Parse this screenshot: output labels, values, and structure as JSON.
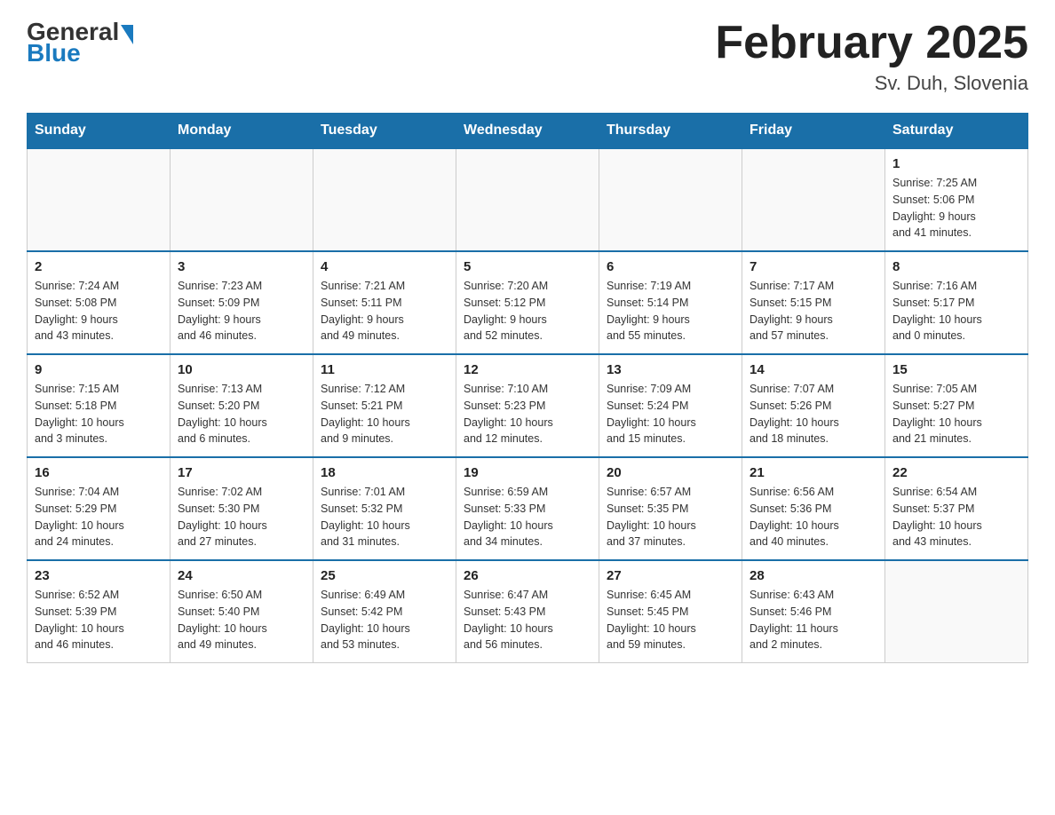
{
  "header": {
    "logo_general": "General",
    "logo_blue": "Blue",
    "month_title": "February 2025",
    "location": "Sv. Duh, Slovenia"
  },
  "days_of_week": [
    "Sunday",
    "Monday",
    "Tuesday",
    "Wednesday",
    "Thursday",
    "Friday",
    "Saturday"
  ],
  "weeks": [
    [
      {
        "day": "",
        "info": ""
      },
      {
        "day": "",
        "info": ""
      },
      {
        "day": "",
        "info": ""
      },
      {
        "day": "",
        "info": ""
      },
      {
        "day": "",
        "info": ""
      },
      {
        "day": "",
        "info": ""
      },
      {
        "day": "1",
        "info": "Sunrise: 7:25 AM\nSunset: 5:06 PM\nDaylight: 9 hours\nand 41 minutes."
      }
    ],
    [
      {
        "day": "2",
        "info": "Sunrise: 7:24 AM\nSunset: 5:08 PM\nDaylight: 9 hours\nand 43 minutes."
      },
      {
        "day": "3",
        "info": "Sunrise: 7:23 AM\nSunset: 5:09 PM\nDaylight: 9 hours\nand 46 minutes."
      },
      {
        "day": "4",
        "info": "Sunrise: 7:21 AM\nSunset: 5:11 PM\nDaylight: 9 hours\nand 49 minutes."
      },
      {
        "day": "5",
        "info": "Sunrise: 7:20 AM\nSunset: 5:12 PM\nDaylight: 9 hours\nand 52 minutes."
      },
      {
        "day": "6",
        "info": "Sunrise: 7:19 AM\nSunset: 5:14 PM\nDaylight: 9 hours\nand 55 minutes."
      },
      {
        "day": "7",
        "info": "Sunrise: 7:17 AM\nSunset: 5:15 PM\nDaylight: 9 hours\nand 57 minutes."
      },
      {
        "day": "8",
        "info": "Sunrise: 7:16 AM\nSunset: 5:17 PM\nDaylight: 10 hours\nand 0 minutes."
      }
    ],
    [
      {
        "day": "9",
        "info": "Sunrise: 7:15 AM\nSunset: 5:18 PM\nDaylight: 10 hours\nand 3 minutes."
      },
      {
        "day": "10",
        "info": "Sunrise: 7:13 AM\nSunset: 5:20 PM\nDaylight: 10 hours\nand 6 minutes."
      },
      {
        "day": "11",
        "info": "Sunrise: 7:12 AM\nSunset: 5:21 PM\nDaylight: 10 hours\nand 9 minutes."
      },
      {
        "day": "12",
        "info": "Sunrise: 7:10 AM\nSunset: 5:23 PM\nDaylight: 10 hours\nand 12 minutes."
      },
      {
        "day": "13",
        "info": "Sunrise: 7:09 AM\nSunset: 5:24 PM\nDaylight: 10 hours\nand 15 minutes."
      },
      {
        "day": "14",
        "info": "Sunrise: 7:07 AM\nSunset: 5:26 PM\nDaylight: 10 hours\nand 18 minutes."
      },
      {
        "day": "15",
        "info": "Sunrise: 7:05 AM\nSunset: 5:27 PM\nDaylight: 10 hours\nand 21 minutes."
      }
    ],
    [
      {
        "day": "16",
        "info": "Sunrise: 7:04 AM\nSunset: 5:29 PM\nDaylight: 10 hours\nand 24 minutes."
      },
      {
        "day": "17",
        "info": "Sunrise: 7:02 AM\nSunset: 5:30 PM\nDaylight: 10 hours\nand 27 minutes."
      },
      {
        "day": "18",
        "info": "Sunrise: 7:01 AM\nSunset: 5:32 PM\nDaylight: 10 hours\nand 31 minutes."
      },
      {
        "day": "19",
        "info": "Sunrise: 6:59 AM\nSunset: 5:33 PM\nDaylight: 10 hours\nand 34 minutes."
      },
      {
        "day": "20",
        "info": "Sunrise: 6:57 AM\nSunset: 5:35 PM\nDaylight: 10 hours\nand 37 minutes."
      },
      {
        "day": "21",
        "info": "Sunrise: 6:56 AM\nSunset: 5:36 PM\nDaylight: 10 hours\nand 40 minutes."
      },
      {
        "day": "22",
        "info": "Sunrise: 6:54 AM\nSunset: 5:37 PM\nDaylight: 10 hours\nand 43 minutes."
      }
    ],
    [
      {
        "day": "23",
        "info": "Sunrise: 6:52 AM\nSunset: 5:39 PM\nDaylight: 10 hours\nand 46 minutes."
      },
      {
        "day": "24",
        "info": "Sunrise: 6:50 AM\nSunset: 5:40 PM\nDaylight: 10 hours\nand 49 minutes."
      },
      {
        "day": "25",
        "info": "Sunrise: 6:49 AM\nSunset: 5:42 PM\nDaylight: 10 hours\nand 53 minutes."
      },
      {
        "day": "26",
        "info": "Sunrise: 6:47 AM\nSunset: 5:43 PM\nDaylight: 10 hours\nand 56 minutes."
      },
      {
        "day": "27",
        "info": "Sunrise: 6:45 AM\nSunset: 5:45 PM\nDaylight: 10 hours\nand 59 minutes."
      },
      {
        "day": "28",
        "info": "Sunrise: 6:43 AM\nSunset: 5:46 PM\nDaylight: 11 hours\nand 2 minutes."
      },
      {
        "day": "",
        "info": ""
      }
    ]
  ]
}
